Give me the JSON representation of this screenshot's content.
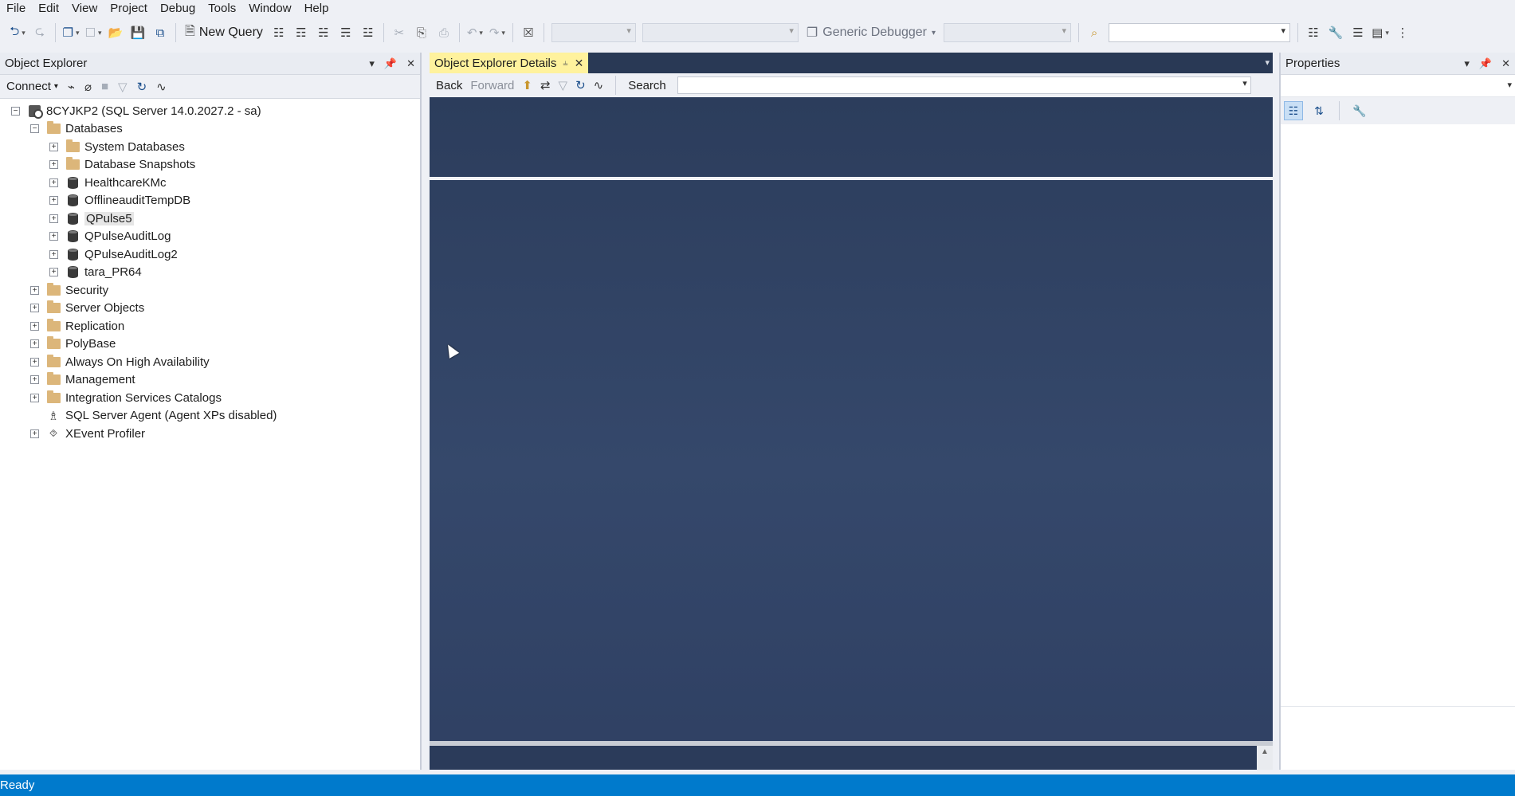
{
  "menu": [
    "File",
    "Edit",
    "View",
    "Project",
    "Debug",
    "Tools",
    "Window",
    "Help"
  ],
  "toolbar": {
    "new_query": "New Query",
    "debugger": "Generic Debugger",
    "icons": [
      "back-icon",
      "forward-icon",
      "new-project-icon",
      "add-item-icon",
      "open-file-icon",
      "save-icon",
      "save-all-icon"
    ]
  },
  "object_explorer": {
    "title": "Object Explorer",
    "connect_label": "Connect",
    "tree": [
      {
        "label": "8CYJKP2 (SQL Server 14.0.2027.2 - sa)",
        "level": 0,
        "expander": "minus",
        "icon": "server-icon"
      },
      {
        "label": "Databases",
        "level": 1,
        "expander": "minus",
        "icon": "folder-icon"
      },
      {
        "label": "System Databases",
        "level": 2,
        "expander": "plus",
        "icon": "folder-icon"
      },
      {
        "label": "Database Snapshots",
        "level": 2,
        "expander": "plus",
        "icon": "folder-icon"
      },
      {
        "label": "HealthcareKMc",
        "level": 2,
        "expander": "plus",
        "icon": "database-icon"
      },
      {
        "label": "OfflineauditTempDB",
        "level": 2,
        "expander": "plus",
        "icon": "database-icon"
      },
      {
        "label": "QPulse5",
        "level": 2,
        "expander": "plus",
        "icon": "database-icon",
        "selected": true
      },
      {
        "label": "QPulseAuditLog",
        "level": 2,
        "expander": "plus",
        "icon": "database-icon"
      },
      {
        "label": "QPulseAuditLog2",
        "level": 2,
        "expander": "plus",
        "icon": "database-icon"
      },
      {
        "label": "tara_PR64",
        "level": 2,
        "expander": "plus",
        "icon": "database-icon"
      },
      {
        "label": "Security",
        "level": 1,
        "expander": "plus",
        "icon": "folder-icon"
      },
      {
        "label": "Server Objects",
        "level": 1,
        "expander": "plus",
        "icon": "folder-icon"
      },
      {
        "label": "Replication",
        "level": 1,
        "expander": "plus",
        "icon": "folder-icon"
      },
      {
        "label": "PolyBase",
        "level": 1,
        "expander": "plus",
        "icon": "folder-icon"
      },
      {
        "label": "Always On High Availability",
        "level": 1,
        "expander": "plus",
        "icon": "folder-icon"
      },
      {
        "label": "Management",
        "level": 1,
        "expander": "plus",
        "icon": "folder-icon"
      },
      {
        "label": "Integration Services Catalogs",
        "level": 1,
        "expander": "plus",
        "icon": "folder-icon"
      },
      {
        "label": "SQL Server Agent (Agent XPs disabled)",
        "level": 1,
        "expander": "none",
        "icon": "agent-icon"
      },
      {
        "label": "XEvent Profiler",
        "level": 1,
        "expander": "plus",
        "icon": "profiler-icon"
      }
    ]
  },
  "details": {
    "tab_title": "Object Explorer Details",
    "back_label": "Back",
    "forward_label": "Forward",
    "search_label": "Search",
    "search_value": ""
  },
  "properties": {
    "title": "Properties"
  },
  "status": {
    "text": "Ready"
  },
  "colors": {
    "status_bar": "#007acc",
    "active_tab": "#fff29d",
    "document_background": "#2d3e5e",
    "folder": "#dcb67a"
  }
}
